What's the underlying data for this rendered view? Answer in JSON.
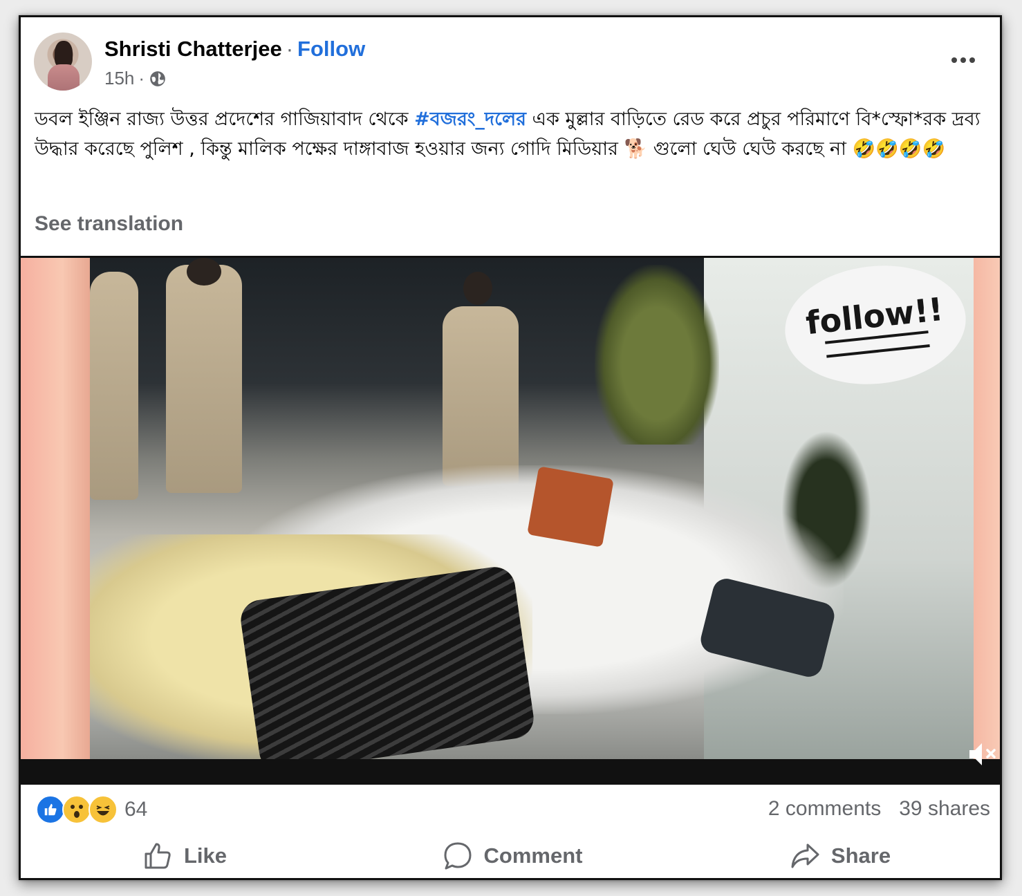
{
  "post": {
    "author": "Shristi Chatterjee",
    "separator": "·",
    "follow_label": "Follow",
    "time": "15h",
    "time_separator": "·",
    "privacy_icon": "globe-icon",
    "more_icon": "more-dots-icon",
    "text_before_hashtag": "ডবল ইঞ্জিন রাজ্য উত্তর প্রদেশের গাজিয়াবাদ থেকে ",
    "hashtag": "#বজরং_দলের",
    "text_after_hashtag": " এক মুল্লার বাড়িতে রেড করে প্রচুর পরিমাণে বি*স্ফো*রক দ্রব্য উদ্ধার করেছে পুলিশ , কিন্তু মালিক পক্ষের দাঙ্গাবাজ হওয়ার জন্য গোদি মিডিয়ার 🐕 গুলো ঘেউ ঘেউ করছে না 🤣🤣🤣🤣",
    "see_translation": "See translation"
  },
  "media": {
    "sticker_text": "follow!!",
    "mute_icon": "volume-muted-icon"
  },
  "engagement": {
    "reaction_icons": [
      "like-reaction-icon",
      "wow-reaction-icon",
      "haha-reaction-icon"
    ],
    "reaction_count": "64",
    "comments": "2 comments",
    "shares": "39 shares"
  },
  "actions": {
    "like": "Like",
    "comment": "Comment",
    "share": "Share"
  },
  "colors": {
    "link_blue": "#216fdb",
    "secondary_text": "#65676b",
    "like_blue": "#1b74e4",
    "reaction_yellow": "#f7c239"
  }
}
